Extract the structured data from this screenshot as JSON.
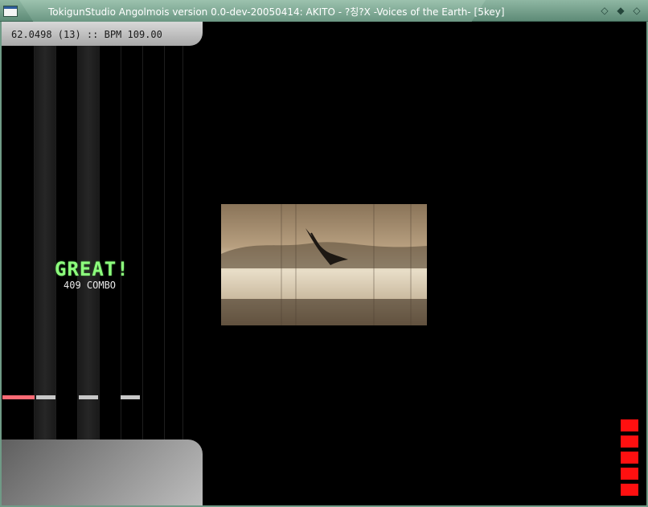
{
  "window": {
    "title": "TokigunStudio Angolmois version 0.0-dev-20050414: AKITO - ?칭?X -Voices of the Earth- [5key]",
    "controls": [
      "minimize-icon",
      "maximize-icon",
      "close-icon"
    ]
  },
  "hud": {
    "status_line": "62.0498 (13) :: BPM 109.00"
  },
  "judgement": {
    "grade": "GREAT!",
    "combo": "409 COMBO"
  },
  "lanes": 5,
  "gauge_blocks": 5,
  "colors": {
    "frame": "#6f9a86",
    "judge_text": "#8dff7d",
    "gauge": "#ff1010",
    "hit_line_red": "#ff6b75",
    "hit_line_white": "#c8c8c8"
  },
  "bga": {
    "description_icon": "bird-in-sky-image"
  }
}
